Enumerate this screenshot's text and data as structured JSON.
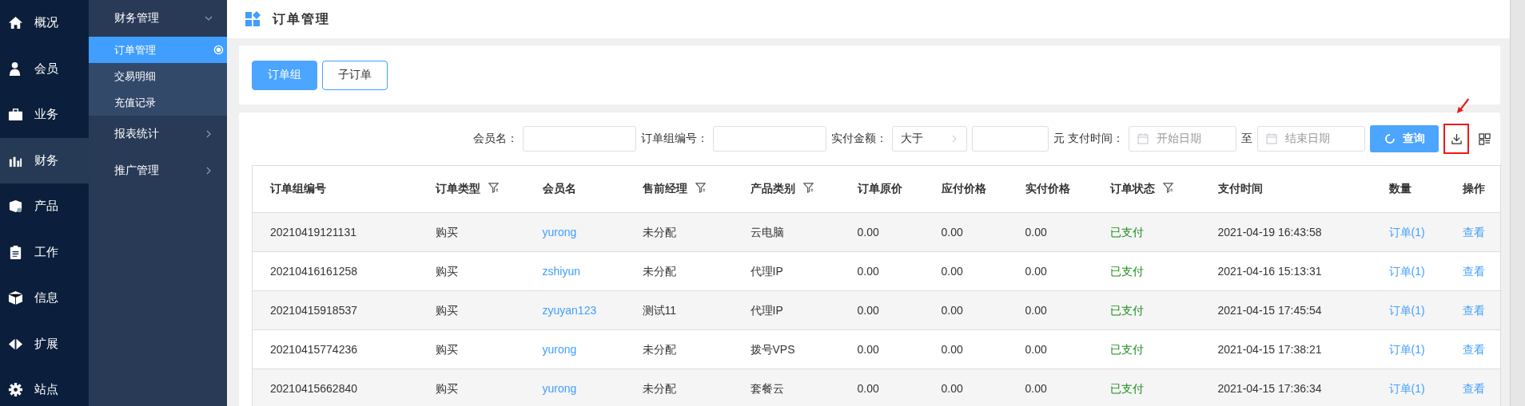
{
  "nav": [
    {
      "label": "概况",
      "selected": false
    },
    {
      "label": "会员",
      "selected": false
    },
    {
      "label": "业务",
      "selected": false
    },
    {
      "label": "财务",
      "selected": true
    },
    {
      "label": "产品",
      "selected": false
    },
    {
      "label": "工作",
      "selected": false
    },
    {
      "label": "信息",
      "selected": false
    },
    {
      "label": "扩展",
      "selected": false
    },
    {
      "label": "站点",
      "selected": false
    }
  ],
  "submenu": [
    {
      "label": "财务管理",
      "expanded": true,
      "children": [
        {
          "label": "订单管理",
          "selected": true
        },
        {
          "label": "交易明细",
          "selected": false
        },
        {
          "label": "充值记录",
          "selected": false
        }
      ]
    },
    {
      "label": "报表统计",
      "expanded": false
    },
    {
      "label": "推广管理",
      "expanded": false
    }
  ],
  "page_title": "订单管理",
  "tabs": [
    {
      "label": "订单组",
      "selected": true
    },
    {
      "label": "子订单",
      "selected": false
    }
  ],
  "filters": {
    "member": {
      "label": "会员名："
    },
    "group_no": {
      "label": "订单组编号："
    },
    "amount": {
      "label": "实付金额：",
      "operator": "大于",
      "unit": "元"
    },
    "pay_time": {
      "label": "支付时间：",
      "start_placeholder": "开始日期",
      "separator": "至",
      "end_placeholder": "结束日期"
    },
    "search_button": "查询",
    "export_highlighted": true
  },
  "table": {
    "columns": [
      {
        "label": "订单组编号",
        "filterable": false
      },
      {
        "label": "订单类型",
        "filterable": true
      },
      {
        "label": "会员名",
        "filterable": false
      },
      {
        "label": "售前经理",
        "filterable": true
      },
      {
        "label": "产品类别",
        "filterable": true
      },
      {
        "label": "订单原价",
        "filterable": false
      },
      {
        "label": "应付价格",
        "filterable": false
      },
      {
        "label": "实付价格",
        "filterable": false
      },
      {
        "label": "订单状态",
        "filterable": true
      },
      {
        "label": "支付时间",
        "filterable": false
      },
      {
        "label": "数量",
        "filterable": false
      },
      {
        "label": "操作",
        "filterable": false
      }
    ],
    "rows": [
      [
        "20210419121131",
        "购买",
        "yurong",
        "未分配",
        "云电脑",
        "0.00",
        "0.00",
        "0.00",
        "已支付",
        "2021-04-19 16:43:58",
        "订单(1)",
        "查看"
      ],
      [
        "20210416161258",
        "购买",
        "zshiyun",
        "未分配",
        "代理IP",
        "0.00",
        "0.00",
        "0.00",
        "已支付",
        "2021-04-16 15:13:31",
        "订单(1)",
        "查看"
      ],
      [
        "20210415918537",
        "购买",
        "zyuyan123",
        "测试11",
        "代理IP",
        "0.00",
        "0.00",
        "0.00",
        "已支付",
        "2021-04-15 17:45:54",
        "订单(1)",
        "查看"
      ],
      [
        "20210415774236",
        "购买",
        "yurong",
        "未分配",
        "拨号VPS",
        "0.00",
        "0.00",
        "0.00",
        "已支付",
        "2021-04-15 17:38:21",
        "订单(1)",
        "查看"
      ],
      [
        "20210415662840",
        "购买",
        "yurong",
        "未分配",
        "套餐云",
        "0.00",
        "0.00",
        "0.00",
        "已支付",
        "2021-04-15 17:36:34",
        "订单(1)",
        "查看"
      ]
    ]
  }
}
